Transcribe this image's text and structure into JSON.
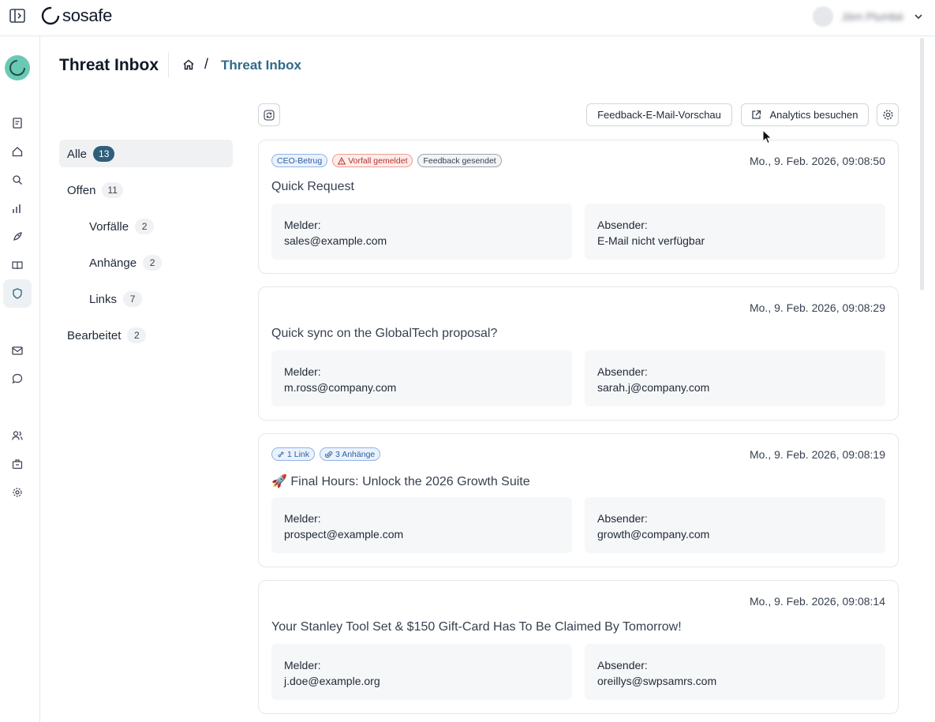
{
  "app": {
    "logo_text": "sosafe",
    "user_name": "Jörn Plumbé"
  },
  "header": {
    "title": "Threat Inbox",
    "breadcrumb_current": "Threat Inbox",
    "breadcrumb_separator": "/"
  },
  "filters": [
    {
      "label": "Alle",
      "count": "13",
      "active": true
    },
    {
      "label": "Offen",
      "count": "11"
    },
    {
      "label": "Vorfälle",
      "count": "2"
    },
    {
      "label": "Anhänge",
      "count": "2"
    },
    {
      "label": "Links",
      "count": "7"
    },
    {
      "label": "Bearbeitet",
      "count": "2"
    }
  ],
  "toolbar": {
    "preview_label": "Feedback-E-Mail-Vorschau",
    "analytics_label": "Analytics besuchen"
  },
  "labels": {
    "reporter": "Melder:",
    "sender": "Absender:"
  },
  "cards": [
    {
      "tags": [
        "CEO-Betrug",
        "Vorfall gemeldet",
        "Feedback gesendet"
      ],
      "date": "Mo., 9. Feb. 2026, 09:08:50",
      "subject": "Quick Request",
      "reporter": "sales@example.com",
      "sender": "E-Mail nicht verfügbar"
    },
    {
      "tags": [],
      "date": "Mo., 9. Feb. 2026, 09:08:29",
      "subject": "Quick sync on the GlobalTech proposal?",
      "reporter": "m.ross@company.com",
      "sender": "sarah.j@company.com"
    },
    {
      "tags": [
        "1 Link",
        "3 Anhänge"
      ],
      "date": "Mo., 9. Feb. 2026, 09:08:19",
      "subject": "🚀 Final Hours: Unlock the 2026 Growth Suite",
      "reporter": "prospect@example.com",
      "sender": "growth@company.com"
    },
    {
      "tags": [],
      "date": "Mo., 9. Feb. 2026, 09:08:14",
      "subject": "Your Stanley Tool Set & $150 Gift-Card Has To Be Claimed By Tomorrow!",
      "reporter": "j.doe@example.org",
      "sender": "oreillys@swpsamrs.com"
    }
  ],
  "colors": {
    "accent": "#2f6a8a",
    "active_badge": "#2f5f7a",
    "logo_teal": "#6ac9b3"
  }
}
